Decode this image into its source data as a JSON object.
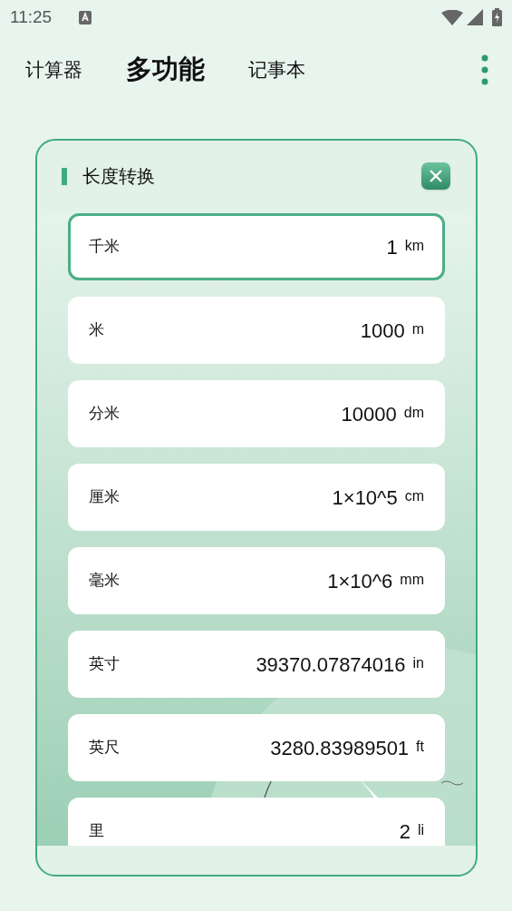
{
  "status_bar": {
    "time": "11:25"
  },
  "tabs": [
    {
      "label": "计算器",
      "selected": false
    },
    {
      "label": "多功能",
      "selected": true
    },
    {
      "label": "记事本",
      "selected": false
    }
  ],
  "panel": {
    "title": "长度转换"
  },
  "units": [
    {
      "name": "千米",
      "value": "1",
      "unit": "km",
      "selected": true
    },
    {
      "name": "米",
      "value": "1000",
      "unit": "m",
      "selected": false
    },
    {
      "name": "分米",
      "value": "10000",
      "unit": "dm",
      "selected": false
    },
    {
      "name": "厘米",
      "value": "1×10^5",
      "unit": "cm",
      "selected": false
    },
    {
      "name": "毫米",
      "value": "1×10^6",
      "unit": "mm",
      "selected": false
    },
    {
      "name": "英寸",
      "value": "39370.07874016",
      "unit": "in",
      "selected": false
    },
    {
      "name": "英尺",
      "value": "3280.83989501",
      "unit": "ft",
      "selected": false
    },
    {
      "name": "里",
      "value": "2",
      "unit": "li",
      "selected": false
    }
  ]
}
